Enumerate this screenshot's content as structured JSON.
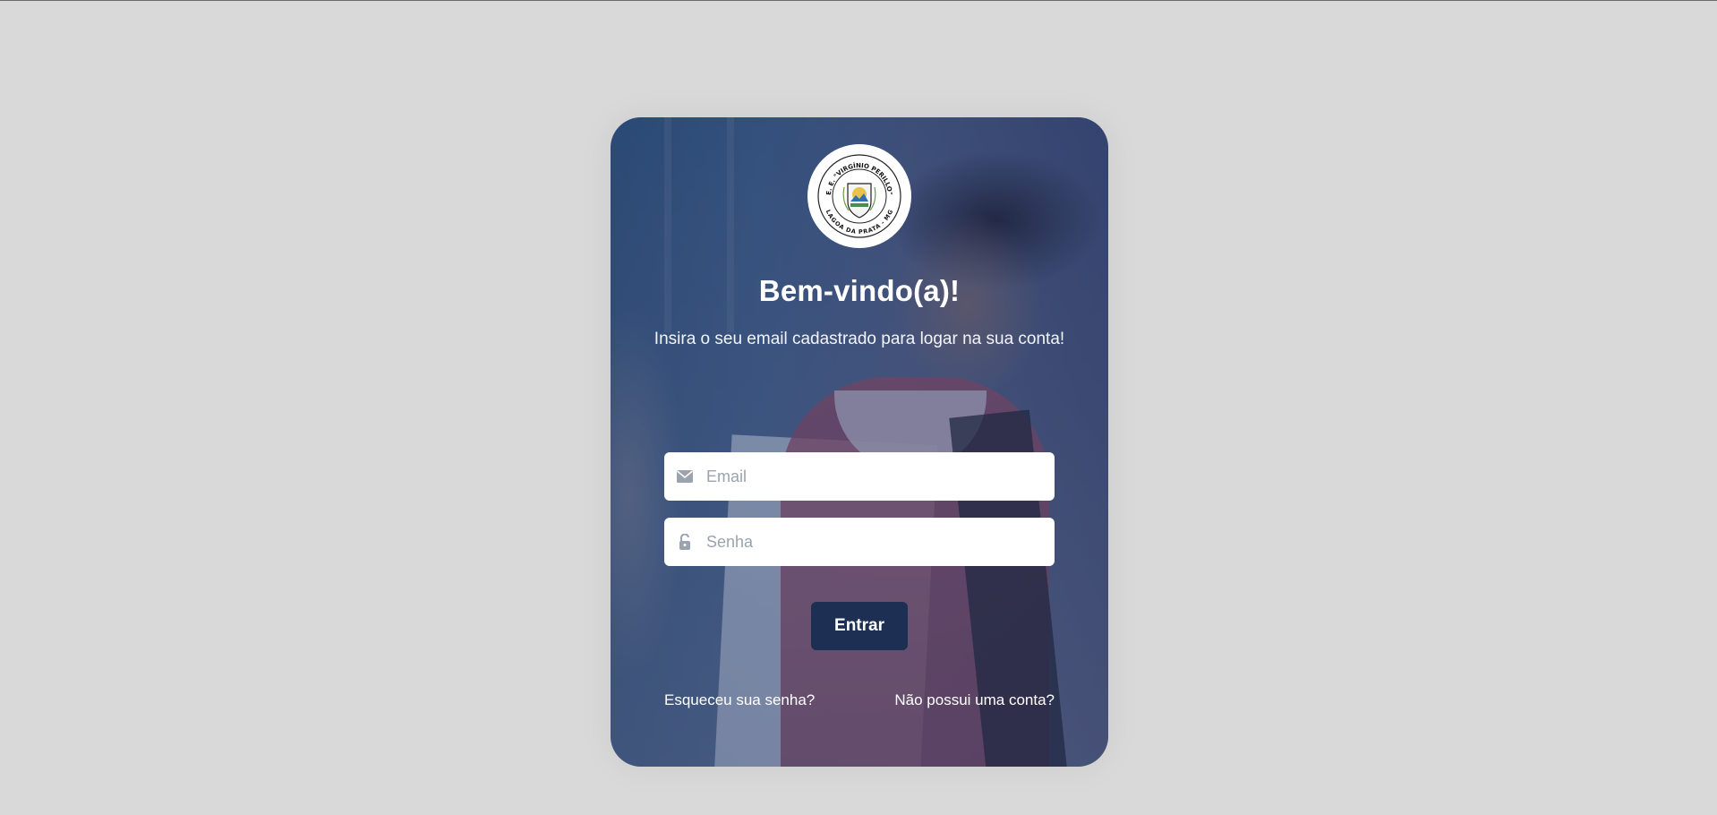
{
  "logo": {
    "top_text": "E. E. \"VIRGÍNIO PERILLO\"",
    "bottom_text": "LAGOA DA PRATA - MG"
  },
  "login": {
    "title": "Bem-vindo(a)!",
    "subtitle": "Insira o seu email cadastrado para logar na sua conta!",
    "email_placeholder": "Email",
    "password_placeholder": "Senha",
    "submit_label": "Entrar",
    "forgot_link": "Esqueceu sua senha?",
    "register_link": "Não possui uma conta?"
  },
  "colors": {
    "page_background": "#d9d9d9",
    "button": "#1d2f52",
    "overlay": "#2c4470",
    "input_background": "#ffffff",
    "placeholder": "#9aa3ae"
  },
  "icons": {
    "email": "envelope-icon",
    "password": "lock-icon"
  }
}
